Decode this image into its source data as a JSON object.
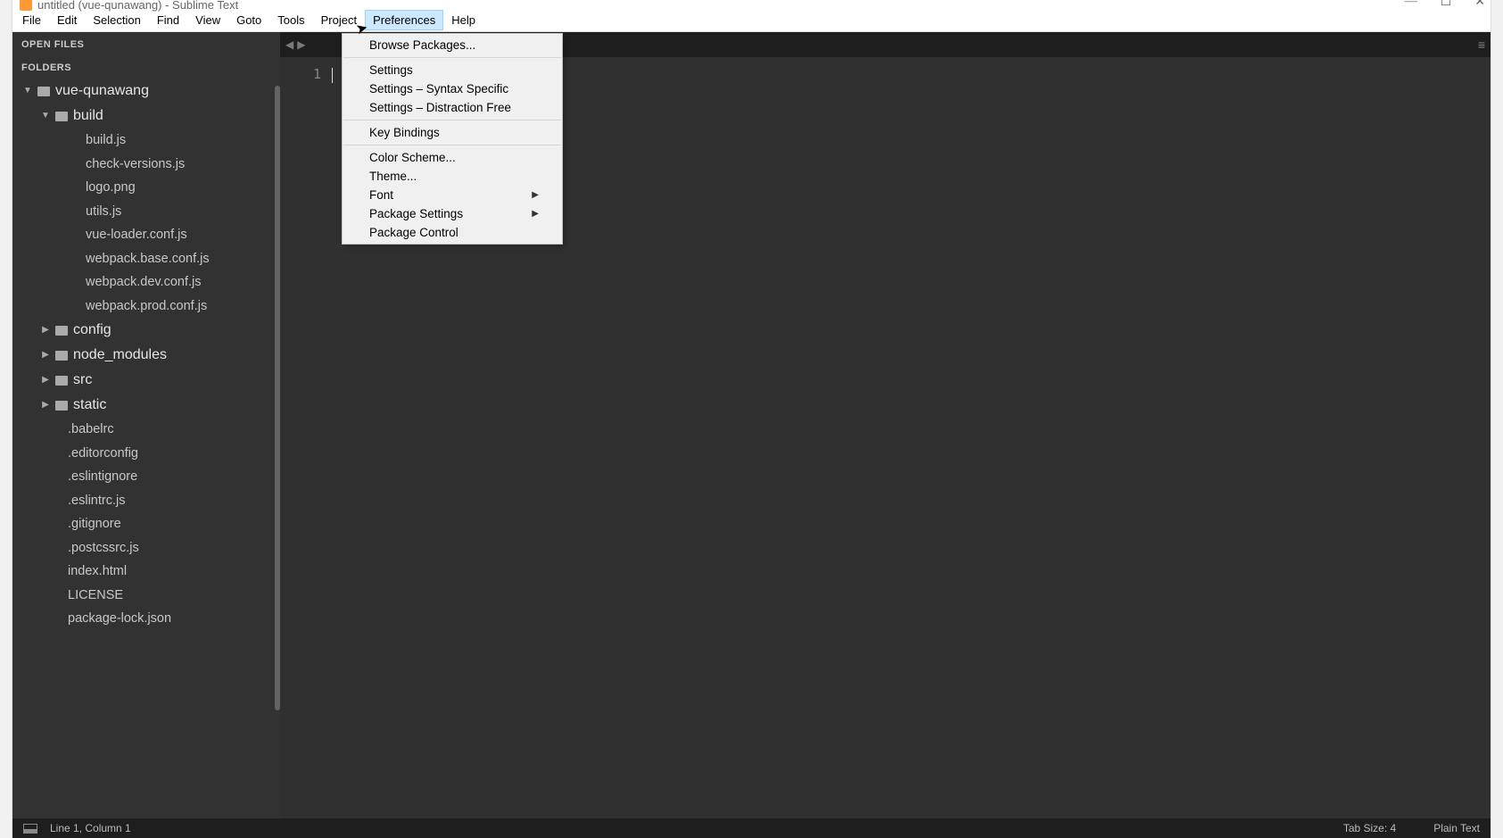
{
  "window": {
    "title": "untitled (vue-qunawang) - Sublime Text"
  },
  "menubar": [
    "File",
    "Edit",
    "Selection",
    "Find",
    "View",
    "Goto",
    "Tools",
    "Project",
    "Preferences",
    "Help"
  ],
  "active_menu": "Preferences",
  "dropdown": {
    "groups": [
      [
        "Browse Packages..."
      ],
      [
        "Settings",
        "Settings – Syntax Specific",
        "Settings – Distraction Free"
      ],
      [
        "Key Bindings"
      ],
      [
        "Color Scheme...",
        "Theme...",
        "Font",
        "Package Settings",
        "Package Control"
      ]
    ],
    "has_submenu": [
      "Font",
      "Package Settings"
    ]
  },
  "sidebar": {
    "open_files_label": "OPEN FILES",
    "folders_label": "FOLDERS",
    "tree": [
      {
        "depth": 0,
        "type": "folder",
        "name": "vue-qunawang",
        "open": true
      },
      {
        "depth": 1,
        "type": "folder",
        "name": "build",
        "open": true
      },
      {
        "depth": 2,
        "type": "file",
        "name": "build.js"
      },
      {
        "depth": 2,
        "type": "file",
        "name": "check-versions.js"
      },
      {
        "depth": 2,
        "type": "file",
        "name": "logo.png"
      },
      {
        "depth": 2,
        "type": "file",
        "name": "utils.js"
      },
      {
        "depth": 2,
        "type": "file",
        "name": "vue-loader.conf.js"
      },
      {
        "depth": 2,
        "type": "file",
        "name": "webpack.base.conf.js"
      },
      {
        "depth": 2,
        "type": "file",
        "name": "webpack.dev.conf.js"
      },
      {
        "depth": 2,
        "type": "file",
        "name": "webpack.prod.conf.js"
      },
      {
        "depth": 1,
        "type": "folder",
        "name": "config",
        "open": false
      },
      {
        "depth": 1,
        "type": "folder",
        "name": "node_modules",
        "open": false
      },
      {
        "depth": 1,
        "type": "folder",
        "name": "src",
        "open": false
      },
      {
        "depth": 1,
        "type": "folder",
        "name": "static",
        "open": false
      },
      {
        "depth": 1,
        "type": "file",
        "name": ".babelrc"
      },
      {
        "depth": 1,
        "type": "file",
        "name": ".editorconfig"
      },
      {
        "depth": 1,
        "type": "file",
        "name": ".eslintignore"
      },
      {
        "depth": 1,
        "type": "file",
        "name": ".eslintrc.js"
      },
      {
        "depth": 1,
        "type": "file",
        "name": ".gitignore"
      },
      {
        "depth": 1,
        "type": "file",
        "name": ".postcssrc.js"
      },
      {
        "depth": 1,
        "type": "file",
        "name": "index.html"
      },
      {
        "depth": 1,
        "type": "file",
        "name": "LICENSE"
      },
      {
        "depth": 1,
        "type": "file",
        "name": "package-lock.json"
      }
    ]
  },
  "editor": {
    "gutter_line": "1"
  },
  "status": {
    "position": "Line 1, Column 1",
    "tabsize": "Tab Size: 4",
    "syntax": "Plain Text"
  }
}
